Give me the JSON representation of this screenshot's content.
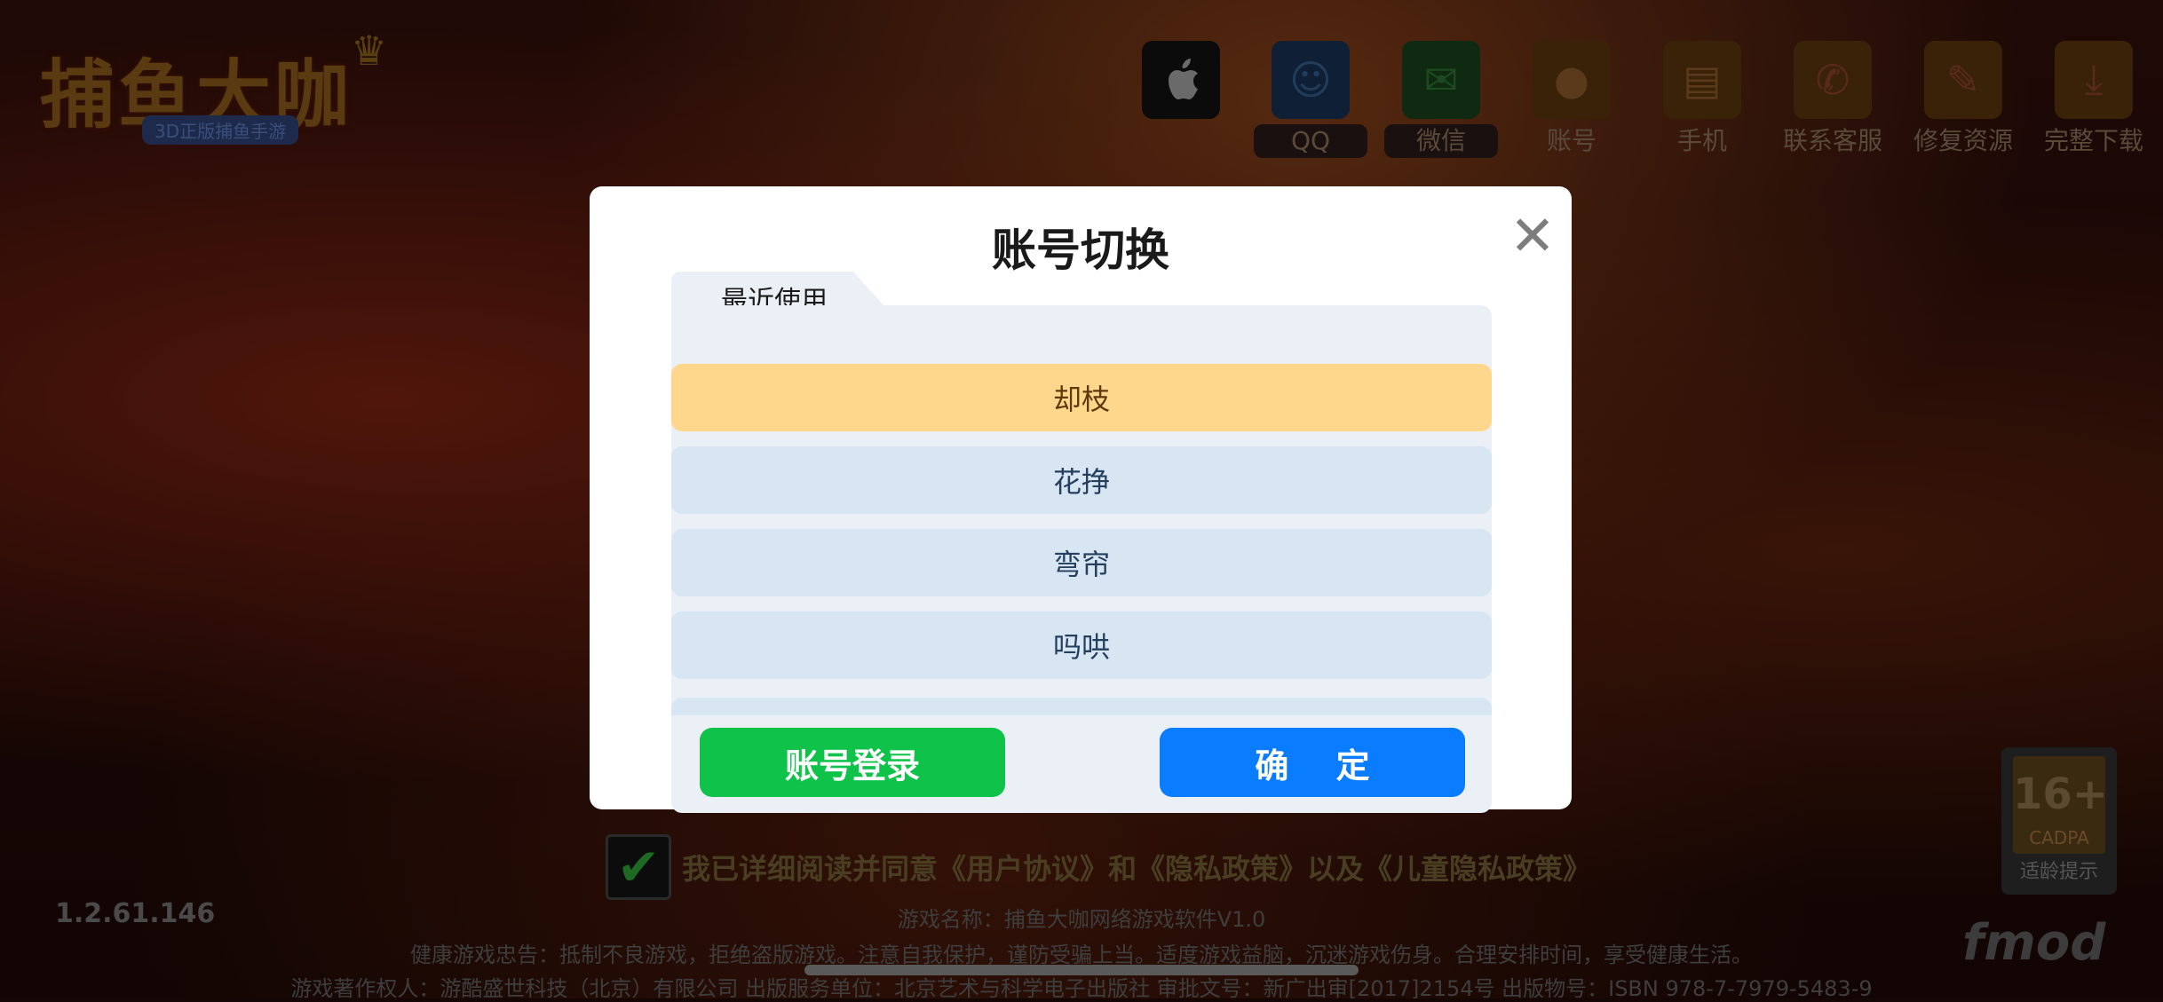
{
  "app": {
    "logo_title": "捕鱼大咖",
    "logo_subtitle": "3D正版捕鱼手游",
    "version": "1.2.61.146"
  },
  "topbar": {
    "items": [
      {
        "label": "",
        "icon": "apple-icon",
        "color": "#0b0b0b"
      },
      {
        "label": "QQ",
        "icon": "qq-icon",
        "color": "#0f1f35"
      },
      {
        "label": "微信",
        "icon": "wechat-icon",
        "color": "#0f2a10"
      },
      {
        "label": "账号",
        "icon": "account-icon",
        "color": "#3a2208"
      },
      {
        "label": "手机",
        "icon": "phone-icon",
        "color": "#3a2208"
      },
      {
        "label": "联系客服",
        "icon": "customer-service-icon",
        "color": "#3a2208"
      },
      {
        "label": "修复资源",
        "icon": "wrench-icon",
        "color": "#3a2208"
      },
      {
        "label": "完整下载",
        "icon": "download-icon",
        "color": "#3a2208"
      }
    ]
  },
  "dialog": {
    "title": "账号切换",
    "tab_label": "最近使用",
    "accounts": [
      "却枝",
      "花挣",
      "弯帘",
      "吗哄"
    ],
    "selected_index": 0,
    "login_button": "账号登录",
    "confirm_button": "确 定"
  },
  "agreement": {
    "checked": true,
    "text": "我已详细阅读并同意《用户协议》和《隐私政策》以及《儿童隐私政策》"
  },
  "footer": {
    "game_name": "游戏名称：捕鱼大咖网络游戏软件V1.0",
    "health_notice": "健康游戏忠告：抵制不良游戏，拒绝盗版游戏。注意自我保护，谨防受骗上当。适度游戏益脑，沉迷游戏伤身。合理安排时间，享受健康生活。",
    "copyright": "游戏著作权人：游酷盛世科技（北京）有限公司   出版服务单位：北京艺术与科学电子出版社      审批文号：新广出审[2017]2154号  出版物号：ISBN 978-7-7979-5483-9"
  },
  "age_rating": {
    "age": "16+",
    "org": "CADPA",
    "tip": "适龄提示"
  },
  "brand": "fmod",
  "colors": {
    "selected_row": "#ffd78c",
    "row": "#d8e5f3",
    "login_button": "#0fc24a",
    "confirm_button": "#0a7cff"
  }
}
